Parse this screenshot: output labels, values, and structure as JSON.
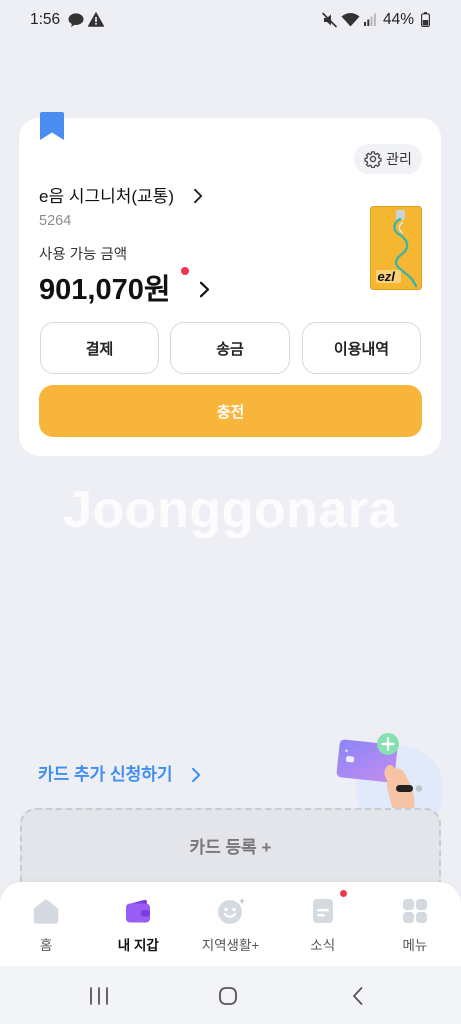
{
  "status_bar": {
    "time": "1:56",
    "battery": "44%",
    "icons": [
      "talk-icon",
      "warning-icon",
      "mute-icon",
      "wifi-icon",
      "signal-icon",
      "battery-icon"
    ]
  },
  "wallet_card": {
    "manage_label": "관리",
    "card_name": "e음 시그니처(교통)",
    "card_number": "5264",
    "balance_label": "사용 가능 금액",
    "balance": "901,070원",
    "card_image_logo": "ezl",
    "actions": [
      {
        "label": "결제"
      },
      {
        "label": "송금"
      },
      {
        "label": "이용내역"
      }
    ],
    "charge_label": "충전"
  },
  "watermark": "Joonggonara",
  "add_card": {
    "apply_label": "카드 추가 신청하기",
    "register_label": "카드 등록 +"
  },
  "bottom_nav": {
    "items": [
      {
        "label": "홈",
        "icon": "home-icon"
      },
      {
        "label": "내 지갑",
        "icon": "wallet-icon",
        "active": true
      },
      {
        "label": "지역생활+",
        "icon": "smile-icon"
      },
      {
        "label": "소식",
        "icon": "news-icon",
        "badge": true
      },
      {
        "label": "메뉴",
        "icon": "menu-grid-icon"
      }
    ]
  },
  "system_nav": {
    "icons": [
      "recent-apps-icon",
      "home-button-icon",
      "back-icon"
    ]
  },
  "colors": {
    "background": "#edeff5",
    "charge_button": "#f7b63b",
    "link_blue": "#3e8ef4",
    "bookmark_blue": "#4a8cf0",
    "active_nav": "#9b5cf5",
    "badge_red": "#f0364f"
  }
}
